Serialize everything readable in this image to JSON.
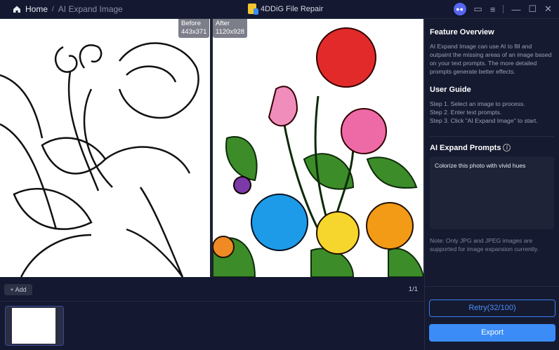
{
  "titlebar": {
    "home": "Home",
    "separator": "/",
    "current": "AI Expand Image",
    "app_name": "4DDiG File Repair"
  },
  "stage": {
    "before_label": "Before",
    "before_size": "443x371",
    "after_label": "After",
    "after_size": "1120x928"
  },
  "panel": {
    "overview_title": "Feature Overview",
    "overview_text": "AI Expand Image can use AI to fill and outpaint the missing areas of an image based on your text prompts. The more detailed prompts generate better effects.",
    "guide_title": "User Guide",
    "steps": [
      "Step 1. Select an image to process.",
      "Step 2. Enter text prompts.",
      "Step 3. Click \"AI Expand Image\" to start."
    ],
    "prompts_title": "AI Expand Prompts",
    "prompt_value": "Colorize this photo with vivid hues",
    "note": "Note: Only JPG and JPEG images are supported for image expansion currently.",
    "retry": "Retry(32/100)",
    "export": "Export"
  },
  "bottom": {
    "add": "Add",
    "page": "1/1"
  },
  "colors": {
    "accent": "#3b8cf7",
    "bg": "#141830"
  }
}
